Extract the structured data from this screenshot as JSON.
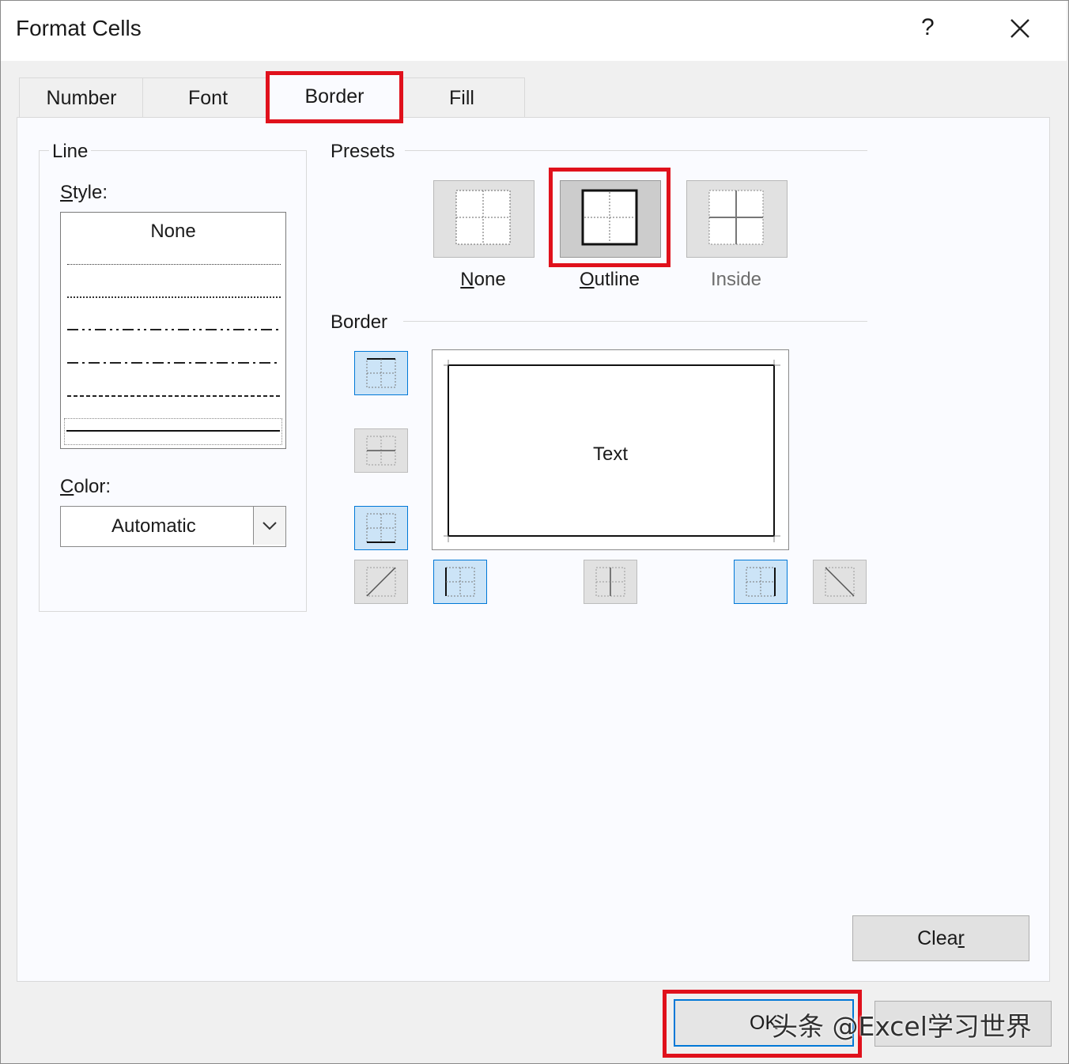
{
  "window": {
    "title": "Format Cells",
    "help": "?"
  },
  "tabs": [
    {
      "label": "Number"
    },
    {
      "label": "Font"
    },
    {
      "label": "Border"
    },
    {
      "label": "Fill"
    }
  ],
  "line": {
    "group_label": "Line",
    "style_label": "Style:",
    "style_none": "None",
    "color_label": "Color:",
    "color_value": "Automatic"
  },
  "presets": {
    "group_label": "Presets",
    "items": [
      {
        "label": "None",
        "selected": false
      },
      {
        "label": "Outline",
        "selected": true
      },
      {
        "label": "Inside",
        "selected": false,
        "disabled": true
      }
    ]
  },
  "border": {
    "group_label": "Border",
    "preview_text": "Text"
  },
  "buttons": {
    "clear": "Clear",
    "ok": "OK"
  },
  "watermark": "头条 @Excel学习世界",
  "colors": {
    "highlight": "#e0111c",
    "selected_fill": "#cce4f7",
    "selected_border": "#0078d7"
  }
}
